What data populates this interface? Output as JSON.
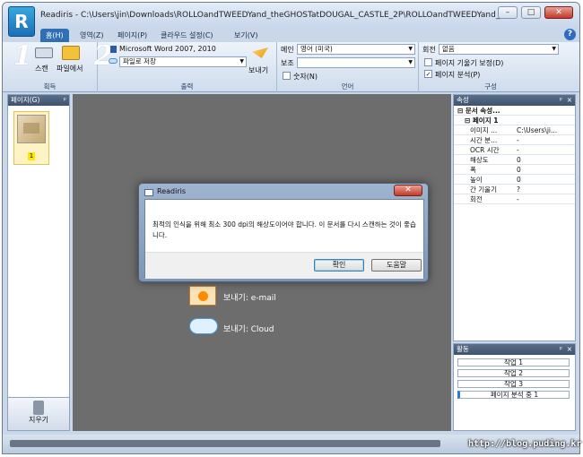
{
  "window": {
    "title": "Readiris - C:\\Users\\jin\\Downloads\\ROLLOandTWEEDYand_theGHOSTatDOUGAL_CASTLE_2P\\ROLLOandTWEEDYand_theGHOSTatDOUGAL_CA...",
    "logo_letter": "R",
    "controls": {
      "minimize": "–",
      "maximize": "□",
      "close": "✕"
    }
  },
  "tabs": [
    {
      "label": "홈(H)"
    },
    {
      "label": "영역(Z)"
    },
    {
      "label": "페이지(P)"
    },
    {
      "label": "클라우드 설정(C)"
    },
    {
      "label": "보기(V)"
    }
  ],
  "help_label": "?",
  "ribbon": {
    "acquire": {
      "num": "1",
      "scan_label": "스캔",
      "file_label": "파일에서",
      "group_name": "획득"
    },
    "output": {
      "num": "2",
      "format": "Microsoft Word 2007, 2010",
      "destination": "파일로 저장",
      "send_label": "보내기",
      "group_name": "출력"
    },
    "language": {
      "main_label": "메인",
      "main_value": "영어 (미국)",
      "secondary_label": "보조",
      "secondary_value": "",
      "digits_label": "숫자(N)",
      "group_name": "언어"
    },
    "structure": {
      "rotate_label": "회전",
      "rotate_value": "없음",
      "deskew_label": "페이지 기울기 보정(D)",
      "analysis_label": "페이지 분석(P)",
      "group_name": "구성"
    }
  },
  "pages_pane": {
    "title": "페이지(G)",
    "pin": "ᵖ",
    "page_number": "1",
    "erase_label": "지우기"
  },
  "center": {
    "send_email": "보내기: e-mail",
    "send_cloud": "보내기: Cloud"
  },
  "properties_pane": {
    "title": "속성",
    "pin": "ᵖ",
    "close": "×",
    "section": "⊟ 문서 속성...",
    "subsection": "⊟ 페이지 1",
    "rows": [
      {
        "k": "이미지 ...",
        "v": "C:\\Users\\ji..."
      },
      {
        "k": "시간 분...",
        "v": "-"
      },
      {
        "k": "OCR 시간",
        "v": "-"
      },
      {
        "k": "해상도",
        "v": "0"
      },
      {
        "k": "폭",
        "v": "0"
      },
      {
        "k": "높이",
        "v": "0"
      },
      {
        "k": "간 기울기",
        "v": "?"
      },
      {
        "k": "회전",
        "v": "-"
      }
    ]
  },
  "activity_pane": {
    "title": "활동",
    "jobs": [
      "작업 1",
      "작업 2",
      "작업 3",
      "페이지 분석 중 1"
    ]
  },
  "dialog": {
    "title": "Readiris",
    "close": "✕",
    "message": "최적의 인식을 위해 최소 300 dpi의 해상도이어야 합니다. 이 문서를 다시 스캔하는 것이 좋습니다.",
    "ok_label": "확인",
    "help_label": "도움말"
  },
  "watermark": "http://blog.puding.kr"
}
